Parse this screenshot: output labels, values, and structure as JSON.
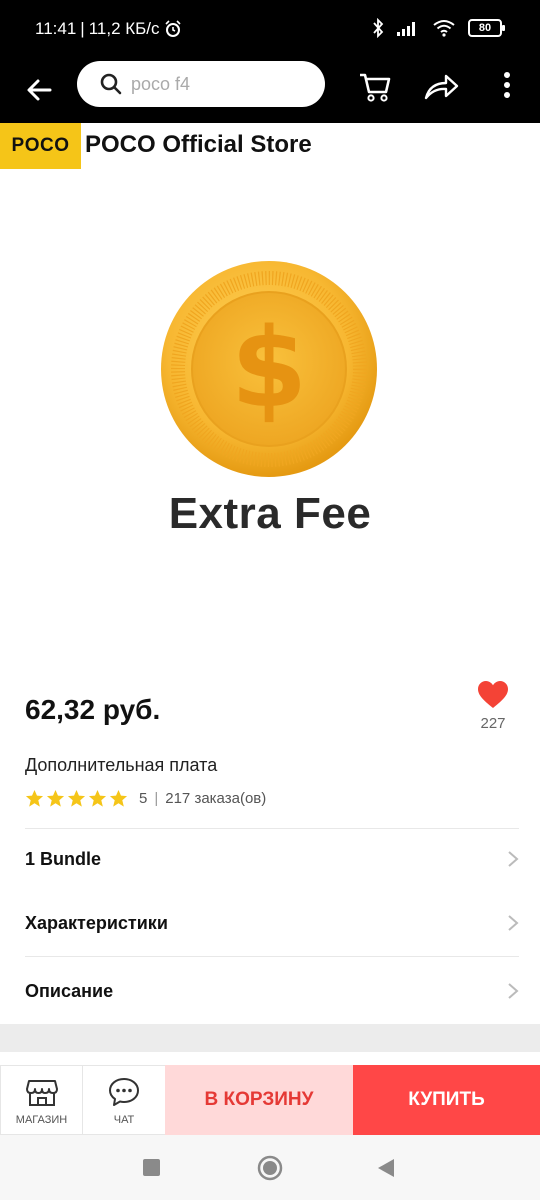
{
  "status_bar": {
    "time": "11:41",
    "network_speed": "11,2 КБ/с",
    "battery": "80",
    "icons": [
      "alarm-icon",
      "bluetooth-icon",
      "signal-icon",
      "wifi-icon",
      "battery-icon"
    ]
  },
  "top_nav": {
    "search_placeholder": "poco f4",
    "icons": [
      "back-arrow-icon",
      "search-icon",
      "cart-icon",
      "share-icon",
      "more-vertical-icon"
    ]
  },
  "store": {
    "logo_text": "POCO",
    "name": "POCO Official Store",
    "logo_color": "#f5c518"
  },
  "product_image": {
    "caption": "Extra Fee",
    "coin_symbol": "$",
    "coin_color": "#f7b731"
  },
  "product": {
    "price": "62,32 руб.",
    "wishlist_count": "227",
    "title": "Дополнительная плата",
    "rating_value": "5",
    "rating_stars": 5,
    "orders": "217 заказа(ов)",
    "star_color": "#f5c518",
    "heart_color": "#f44336"
  },
  "options": [
    {
      "label": "1 Bundle"
    },
    {
      "label": "Характеристики"
    },
    {
      "label": "Описание"
    }
  ],
  "action_bar": {
    "store_label": "МАГАЗИН",
    "chat_label": "ЧАТ",
    "add_to_cart_label": "В КОРЗИНУ",
    "buy_label": "КУПИТЬ",
    "cart_button_color": "#ffd9d9",
    "buy_button_color": "#ff4747"
  },
  "system_nav": {
    "icons": [
      "recent-apps-icon",
      "home-icon",
      "back-triangle-icon"
    ]
  }
}
